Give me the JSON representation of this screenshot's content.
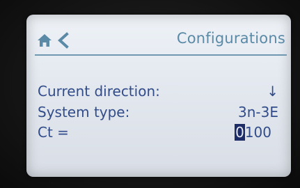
{
  "header": {
    "home_icon": "home-icon",
    "back_icon": "chevron-left-icon",
    "title": "Configurations"
  },
  "rows": [
    {
      "label": "Current direction:",
      "value": "↓"
    },
    {
      "label": "System type:",
      "value": "3n-3E"
    },
    {
      "label": "Ct =",
      "value_selected_digit": "0",
      "value_rest": "100"
    }
  ],
  "colors": {
    "accent": "#5a8aa6",
    "text": "#324c8a",
    "cursor_bg": "#1d2c66",
    "screen_bg": "#e6ebf1"
  }
}
